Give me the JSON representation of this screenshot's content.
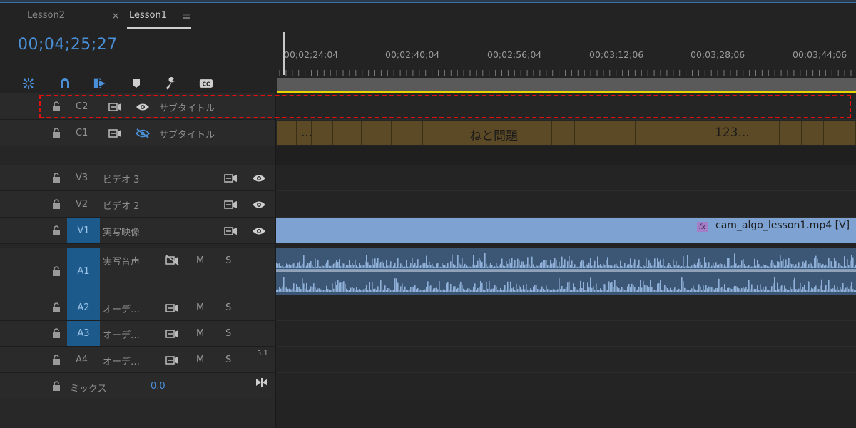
{
  "tabs": [
    {
      "label": "Lesson2"
    },
    {
      "label": "Lesson1"
    }
  ],
  "tab_close": "×",
  "tab_menu": "≡",
  "timecode": "00;04;25;27",
  "toolbar": [
    "snap-icon",
    "magnet-icon",
    "linked-selection-icon",
    "marker-icon",
    "wrench-icon",
    "captions-icon"
  ],
  "ruler": [
    "00;02;24;04",
    "00;02;40;04",
    "00;02;56;04",
    "00;03;12;06",
    "00;03;28;06",
    "00;03;44;06"
  ],
  "caption_tracks": [
    {
      "name": "C2",
      "label": "サブタイトル",
      "visible": true
    },
    {
      "name": "C1",
      "label": "サブタイトル",
      "visible": false
    }
  ],
  "caption_texts": [
    "...",
    "ねと問題",
    "123..."
  ],
  "video_tracks": [
    {
      "name": "V3",
      "label": "ビデオ 3"
    },
    {
      "name": "V2",
      "label": "ビデオ 2"
    },
    {
      "name": "V1",
      "label": "実写映像"
    }
  ],
  "video_clip": {
    "fx": "fx",
    "name": "cam_algo_lesson1.mp4 [V]"
  },
  "audio_tracks": [
    {
      "name": "A1",
      "label": "実写音声",
      "m": "M",
      "s": "S"
    },
    {
      "name": "A2",
      "label": "オーデ…",
      "m": "M",
      "s": "S"
    },
    {
      "name": "A3",
      "label": "オーデ…",
      "m": "M",
      "s": "S"
    },
    {
      "name": "A4",
      "label": "オーデ…",
      "m": "M",
      "s": "S",
      "channel": "5.1"
    }
  ],
  "mix": {
    "label": "ミックス",
    "value": "0.0"
  },
  "colors": {
    "accent": "#4a90d9",
    "track_badge": "#1d5a8c",
    "caption_clip": "#5c4a26",
    "video_clip": "#7ea3d3",
    "audio_clip": "#3c5675",
    "highlight": "#e01010"
  }
}
